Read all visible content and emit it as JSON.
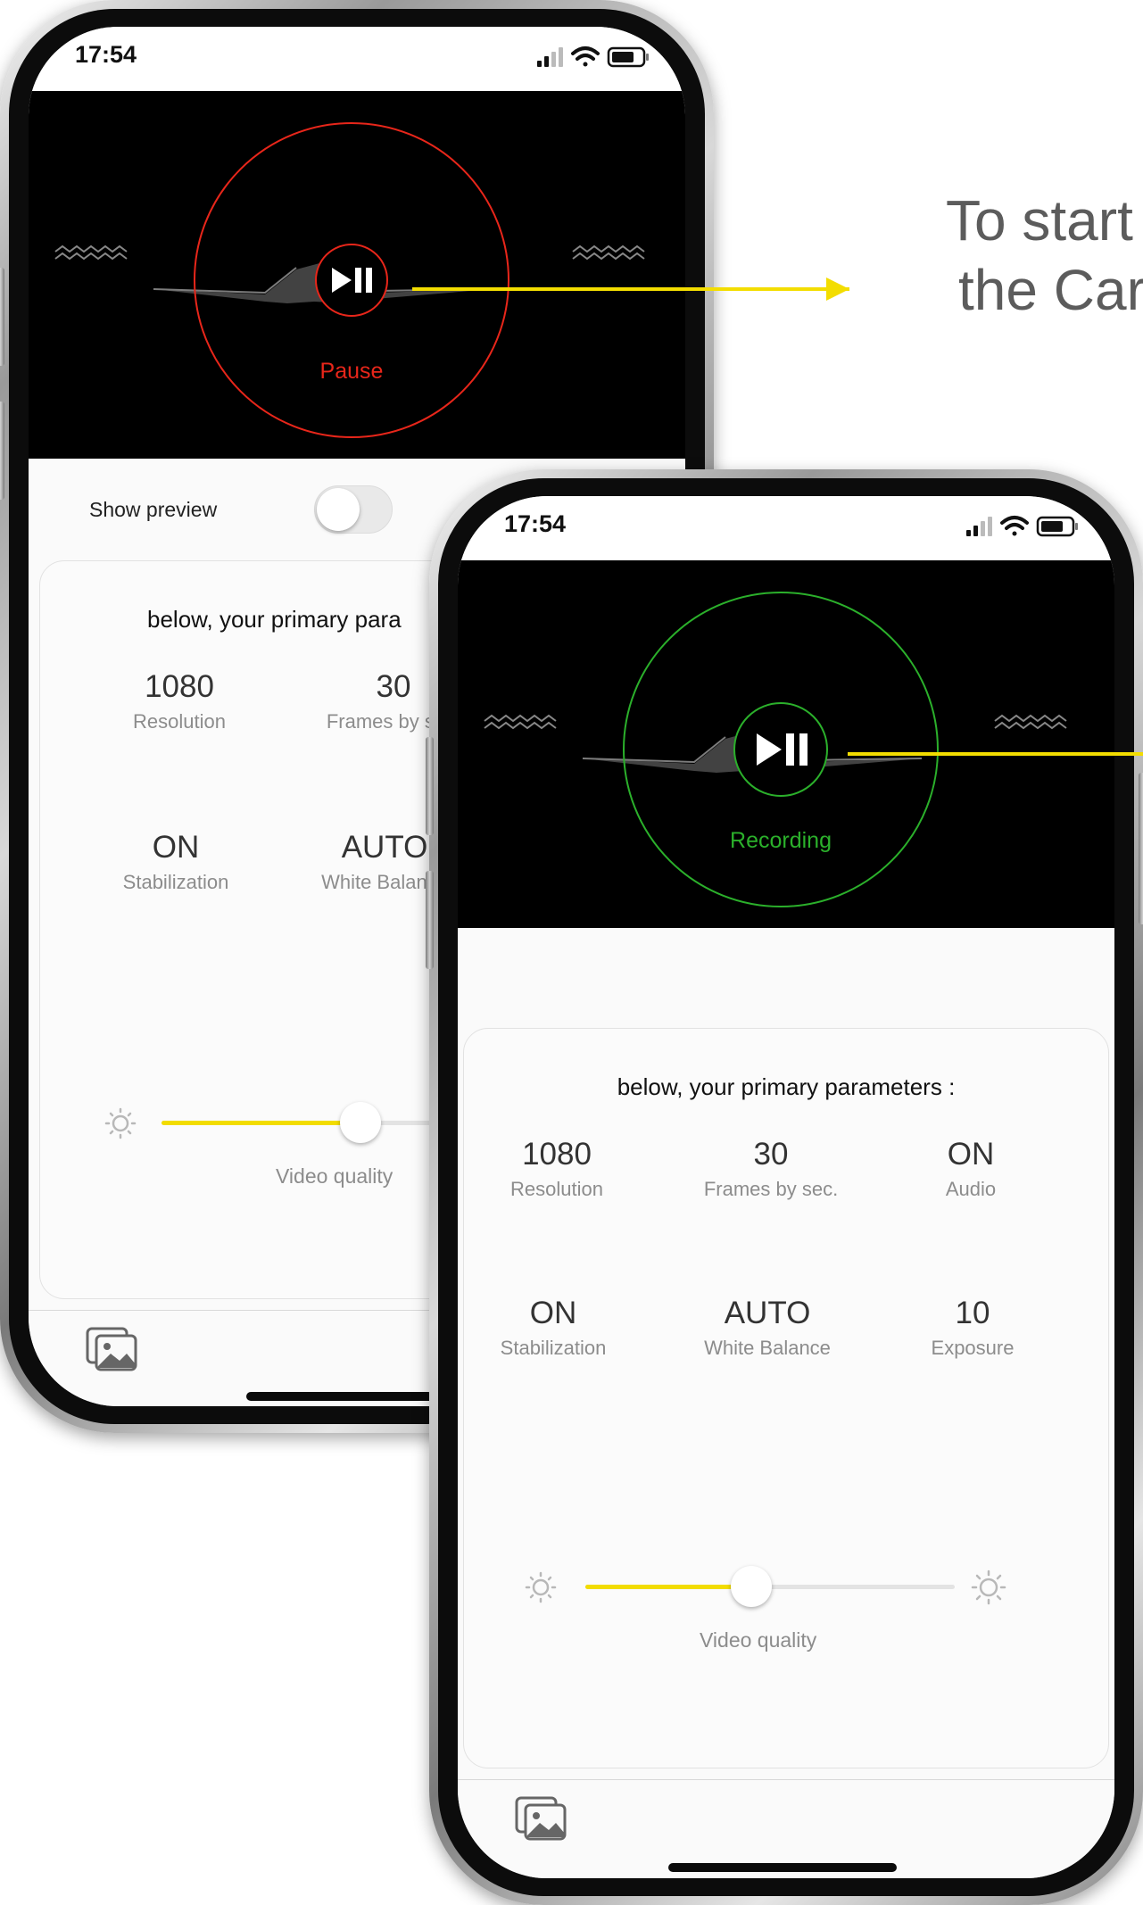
{
  "callout": {
    "line1": "To start",
    "line2": "the Car"
  },
  "back_phone": {
    "status_time": "17:54",
    "camera": {
      "state_label": "Pause",
      "ring_color": "#e8261a"
    },
    "preview": {
      "label": "Show preview",
      "on": false
    },
    "card_title": "below, your primary para",
    "params": [
      {
        "value": "1080",
        "label": "Resolution"
      },
      {
        "value": "30",
        "label": "Frames by sec."
      },
      {
        "value": "ON",
        "label": "Stabilization"
      },
      {
        "value": "AUTO",
        "label": "White Balance"
      }
    ],
    "video_quality": {
      "label": "Video quality",
      "level": 0.53
    },
    "tab_icon": "gallery-icon"
  },
  "front_phone": {
    "status_time": "17:54",
    "camera": {
      "state_label": "Recording",
      "ring_color": "#2bb02b"
    },
    "card_title": "below, your primary parameters :",
    "params": [
      {
        "value": "1080",
        "label": "Resolution"
      },
      {
        "value": "30",
        "label": "Frames by sec."
      },
      {
        "value": "ON",
        "label": "Audio"
      },
      {
        "value": "ON",
        "label": "Stabilization"
      },
      {
        "value": "AUTO",
        "label": "White Balance"
      },
      {
        "value": "10",
        "label": "Exposure"
      }
    ],
    "video_quality": {
      "label": "Video quality",
      "level": 0.45
    },
    "tab_icon": "gallery-icon"
  },
  "colors": {
    "accent_yellow": "#f3dd00",
    "pause_red": "#e8261a",
    "recording_green": "#2bb02b"
  }
}
